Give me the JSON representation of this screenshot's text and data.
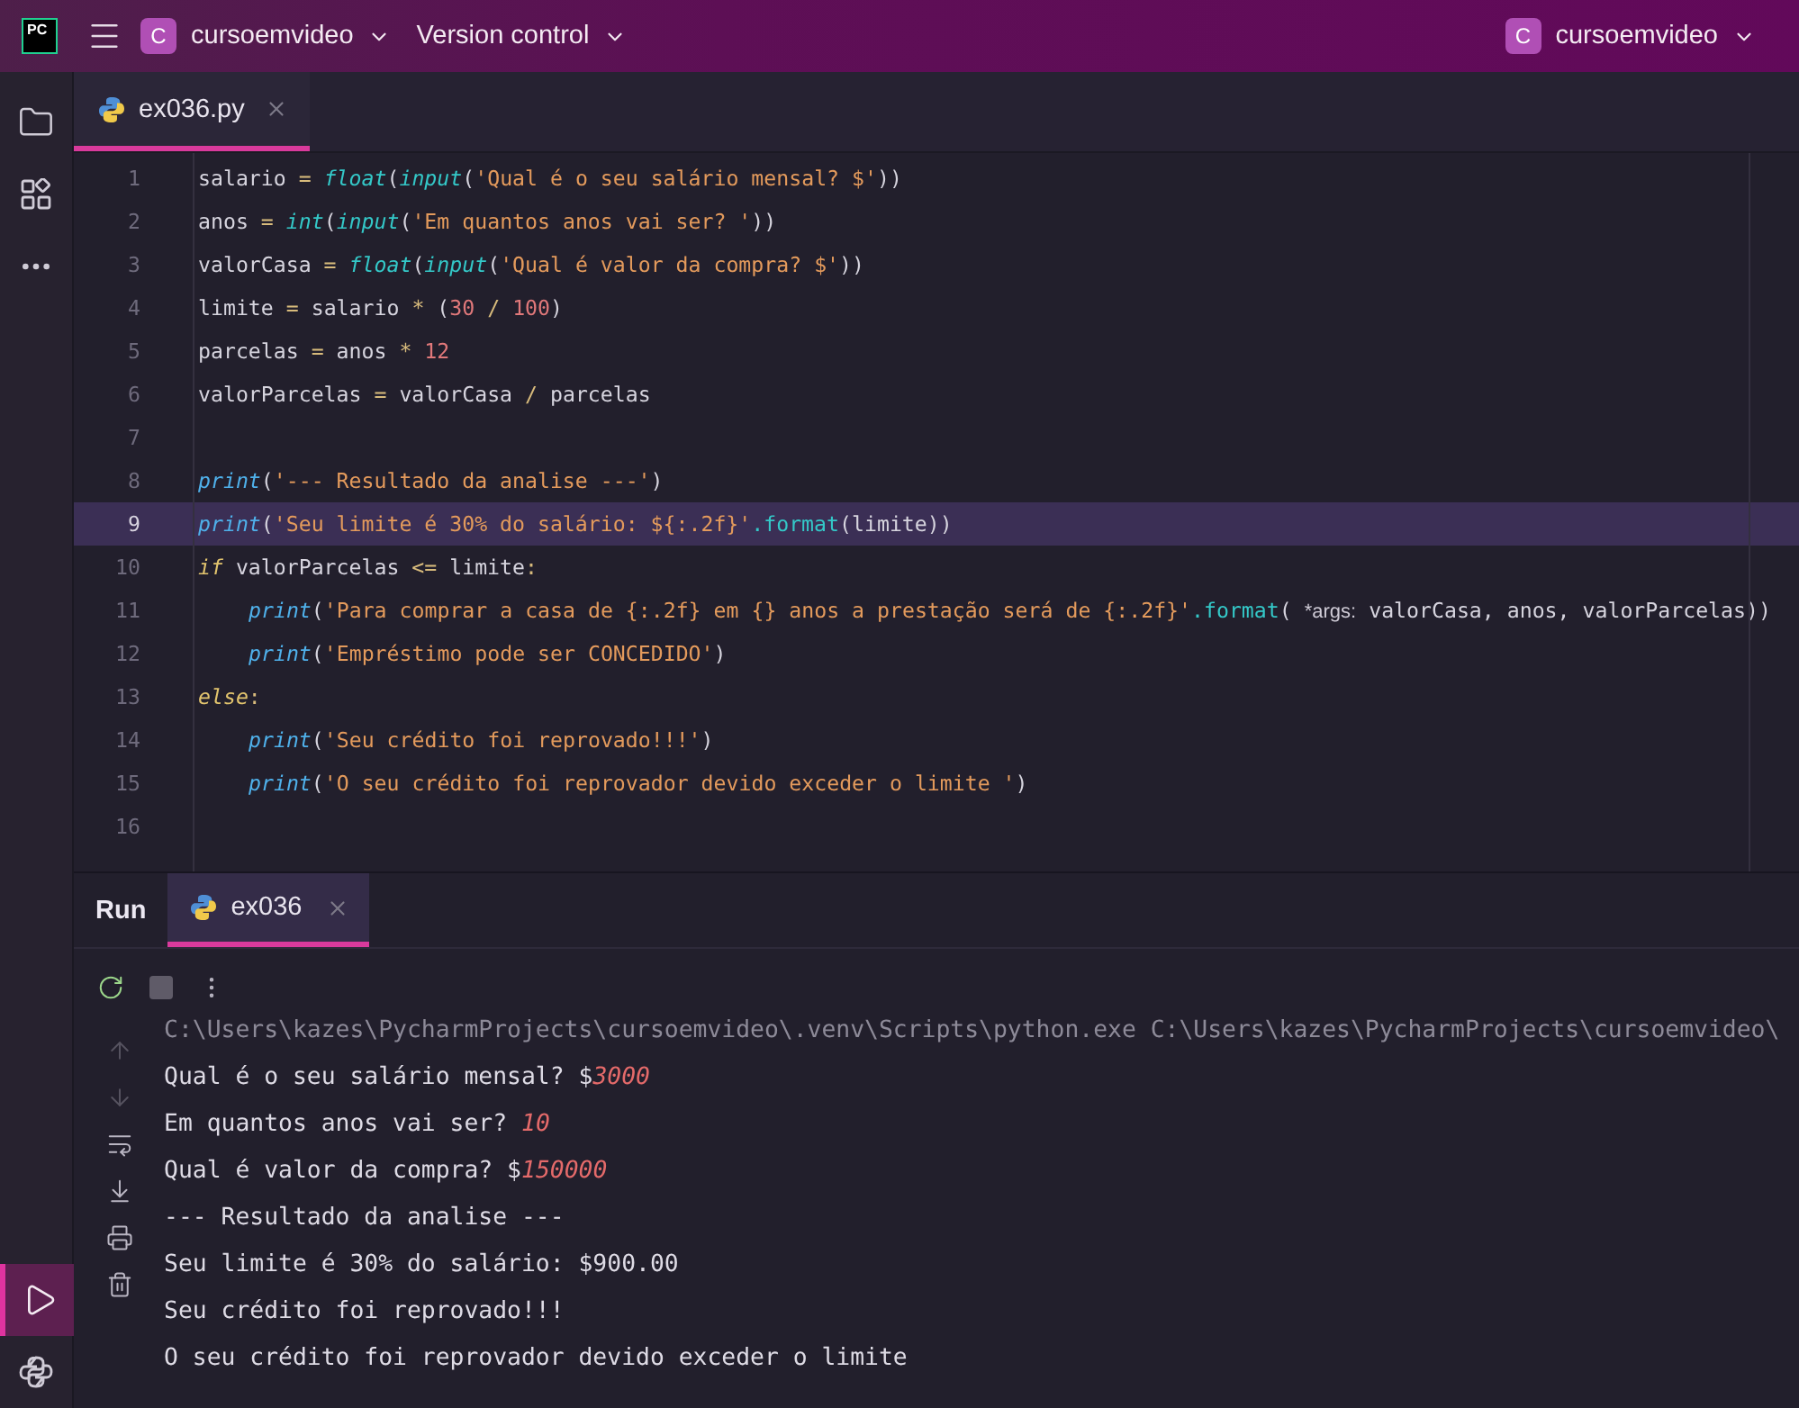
{
  "title_bar": {
    "logo": "PC",
    "project": {
      "badge": "C",
      "name": "cursoemvideo"
    },
    "vcs": "Version control",
    "right_project": {
      "badge": "C",
      "name": "cursoemvideo"
    }
  },
  "tool_strip": {
    "top": [
      {
        "kind": "folder",
        "selected": false
      },
      {
        "kind": "structure",
        "selected": false
      },
      {
        "kind": "more",
        "selected": false
      }
    ],
    "bottom": [
      {
        "kind": "run",
        "selected": true
      },
      {
        "kind": "python",
        "selected": false
      }
    ]
  },
  "editor_tabs": [
    {
      "label": "ex036.py",
      "selected": true
    }
  ],
  "code_lines": [
    {
      "number": "1",
      "current": false,
      "tokens": [
        {
          "kind": "id",
          "text": "salario"
        },
        {
          "kind": "op",
          "text": " = "
        },
        {
          "kind": "builtin",
          "text": "float"
        },
        {
          "kind": "p",
          "text": "("
        },
        {
          "kind": "builtin",
          "text": "input"
        },
        {
          "kind": "p",
          "text": "("
        },
        {
          "kind": "str",
          "text": "'Qual é o seu salário mensal? $'"
        },
        {
          "kind": "p",
          "text": "))"
        }
      ]
    },
    {
      "number": "2",
      "current": false,
      "tokens": [
        {
          "kind": "id",
          "text": "anos"
        },
        {
          "kind": "op",
          "text": " = "
        },
        {
          "kind": "builtin",
          "text": "int"
        },
        {
          "kind": "p",
          "text": "("
        },
        {
          "kind": "builtin",
          "text": "input"
        },
        {
          "kind": "p",
          "text": "("
        },
        {
          "kind": "str",
          "text": "'Em quantos anos vai ser? '"
        },
        {
          "kind": "p",
          "text": "))"
        }
      ]
    },
    {
      "number": "3",
      "current": false,
      "tokens": [
        {
          "kind": "id",
          "text": "valorCasa"
        },
        {
          "kind": "op",
          "text": " = "
        },
        {
          "kind": "builtin",
          "text": "float"
        },
        {
          "kind": "p",
          "text": "("
        },
        {
          "kind": "builtin",
          "text": "input"
        },
        {
          "kind": "p",
          "text": "("
        },
        {
          "kind": "str",
          "text": "'Qual é valor da compra? $'"
        },
        {
          "kind": "p",
          "text": "))"
        }
      ]
    },
    {
      "number": "4",
      "current": false,
      "tokens": [
        {
          "kind": "id",
          "text": "limite"
        },
        {
          "kind": "op",
          "text": " = "
        },
        {
          "kind": "id",
          "text": "salario"
        },
        {
          "kind": "op",
          "text": " * "
        },
        {
          "kind": "p",
          "text": "("
        },
        {
          "kind": "num",
          "text": "30"
        },
        {
          "kind": "op",
          "text": " / "
        },
        {
          "kind": "num",
          "text": "100"
        },
        {
          "kind": "p",
          "text": ")"
        }
      ]
    },
    {
      "number": "5",
      "current": false,
      "tokens": [
        {
          "kind": "id",
          "text": "parcelas"
        },
        {
          "kind": "op",
          "text": " = "
        },
        {
          "kind": "id",
          "text": "anos"
        },
        {
          "kind": "op",
          "text": " * "
        },
        {
          "kind": "num",
          "text": "12"
        }
      ]
    },
    {
      "number": "6",
      "current": false,
      "tokens": [
        {
          "kind": "id",
          "text": "valorParcelas"
        },
        {
          "kind": "op",
          "text": " = "
        },
        {
          "kind": "id",
          "text": "valorCasa"
        },
        {
          "kind": "op",
          "text": " / "
        },
        {
          "kind": "id",
          "text": "parcelas"
        }
      ]
    },
    {
      "number": "7",
      "current": false
    },
    {
      "number": "8",
      "current": false,
      "tokens": [
        {
          "kind": "func",
          "text": "print"
        },
        {
          "kind": "p",
          "text": "("
        },
        {
          "kind": "str",
          "text": "'--- Resultado da analise ---'"
        },
        {
          "kind": "p",
          "text": ")"
        }
      ]
    },
    {
      "number": "9",
      "current": true,
      "tokens": [
        {
          "kind": "func",
          "text": "print"
        },
        {
          "kind": "p",
          "text": "("
        },
        {
          "kind": "str",
          "text": "'Seu limite é 30% do salário: ${:.2f}'"
        },
        {
          "kind": "method",
          "text": ".format"
        },
        {
          "kind": "p",
          "text": "("
        },
        {
          "kind": "id",
          "text": "limite"
        },
        {
          "kind": "p",
          "text": "))"
        }
      ]
    },
    {
      "number": "10",
      "current": false,
      "tokens": [
        {
          "kind": "kw",
          "text": "if"
        },
        {
          "kind": "id",
          "text": " valorParcelas "
        },
        {
          "kind": "op",
          "text": "<="
        },
        {
          "kind": "id",
          "text": " limite"
        },
        {
          "kind": "op",
          "text": ":"
        }
      ],
      "children": [
        {
          "number": "11",
          "current": false,
          "tokens": [
            {
              "kind": "func",
              "text": "print"
            },
            {
              "kind": "p",
              "text": "("
            },
            {
              "kind": "str",
              "text": "'Para comprar a casa de {:.2f} em {} anos a prestação será de {:.2f}'"
            },
            {
              "kind": "method",
              "text": ".format"
            },
            {
              "kind": "p",
              "text": "( "
            },
            {
              "kind": "hint",
              "text": "*args:"
            },
            {
              "kind": "id",
              "text": " valorCasa, anos, valorParcelas"
            },
            {
              "kind": "p",
              "text": "))"
            }
          ]
        },
        {
          "number": "12",
          "current": false,
          "tokens": [
            {
              "kind": "func",
              "text": "print"
            },
            {
              "kind": "p",
              "text": "("
            },
            {
              "kind": "str",
              "text": "'Empréstimo pode ser CONCEDIDO'"
            },
            {
              "kind": "p",
              "text": ")"
            }
          ]
        }
      ]
    },
    {
      "number": "13",
      "current": false,
      "tokens": [
        {
          "kind": "kw",
          "text": "else"
        },
        {
          "kind": "op",
          "text": ":"
        }
      ],
      "children": [
        {
          "number": "14",
          "current": false,
          "tokens": [
            {
              "kind": "func",
              "text": "print"
            },
            {
              "kind": "p",
              "text": "("
            },
            {
              "kind": "str",
              "text": "'Seu crédito foi reprovado!!!'"
            },
            {
              "kind": "p",
              "text": ")"
            }
          ]
        },
        {
          "number": "15",
          "current": false,
          "tokens": [
            {
              "kind": "func",
              "text": "print"
            },
            {
              "kind": "p",
              "text": "("
            },
            {
              "kind": "str",
              "text": "'O seu crédito foi reprovador devido exceder o limite '"
            },
            {
              "kind": "p",
              "text": ")"
            }
          ]
        }
      ]
    },
    {
      "number": "16",
      "current": false
    }
  ],
  "run_panel": {
    "title": "Run",
    "tabs": [
      {
        "label": "ex036",
        "selected": true
      }
    ],
    "toolbar": [
      {
        "kind": "rerun"
      },
      {
        "kind": "stop"
      },
      {
        "kind": "more"
      }
    ],
    "side_tools": [
      {
        "kind": "up",
        "disabled": true
      },
      {
        "kind": "down",
        "disabled": true
      },
      {
        "kind": "wrap",
        "disabled": false
      },
      {
        "kind": "scroll-end",
        "disabled": false
      },
      {
        "kind": "print",
        "disabled": false
      },
      {
        "kind": "trash",
        "disabled": false
      }
    ],
    "console_lines": [
      {
        "kind": "command",
        "text": "C:\\Users\\kazes\\PycharmProjects\\cursoemvideo\\.venv\\Scripts\\python.exe C:\\Users\\kazes\\PycharmProjects\\cursoemvideo\\"
      },
      {
        "kind": "output",
        "text": "Qual é o seu salário mensal? $",
        "input": "3000"
      },
      {
        "kind": "output",
        "text": "Em quantos anos vai ser? ",
        "input": "10"
      },
      {
        "kind": "output",
        "text": "Qual é valor da compra? $",
        "input": "150000"
      },
      {
        "kind": "output",
        "text": "--- Resultado da analise ---"
      },
      {
        "kind": "output",
        "text": "Seu limite é 30% do salário: $900.00"
      },
      {
        "kind": "output",
        "text": "Seu crédito foi reprovado!!!"
      },
      {
        "kind": "output",
        "text": "O seu crédito foi reprovador devido exceder o limite"
      }
    ]
  }
}
